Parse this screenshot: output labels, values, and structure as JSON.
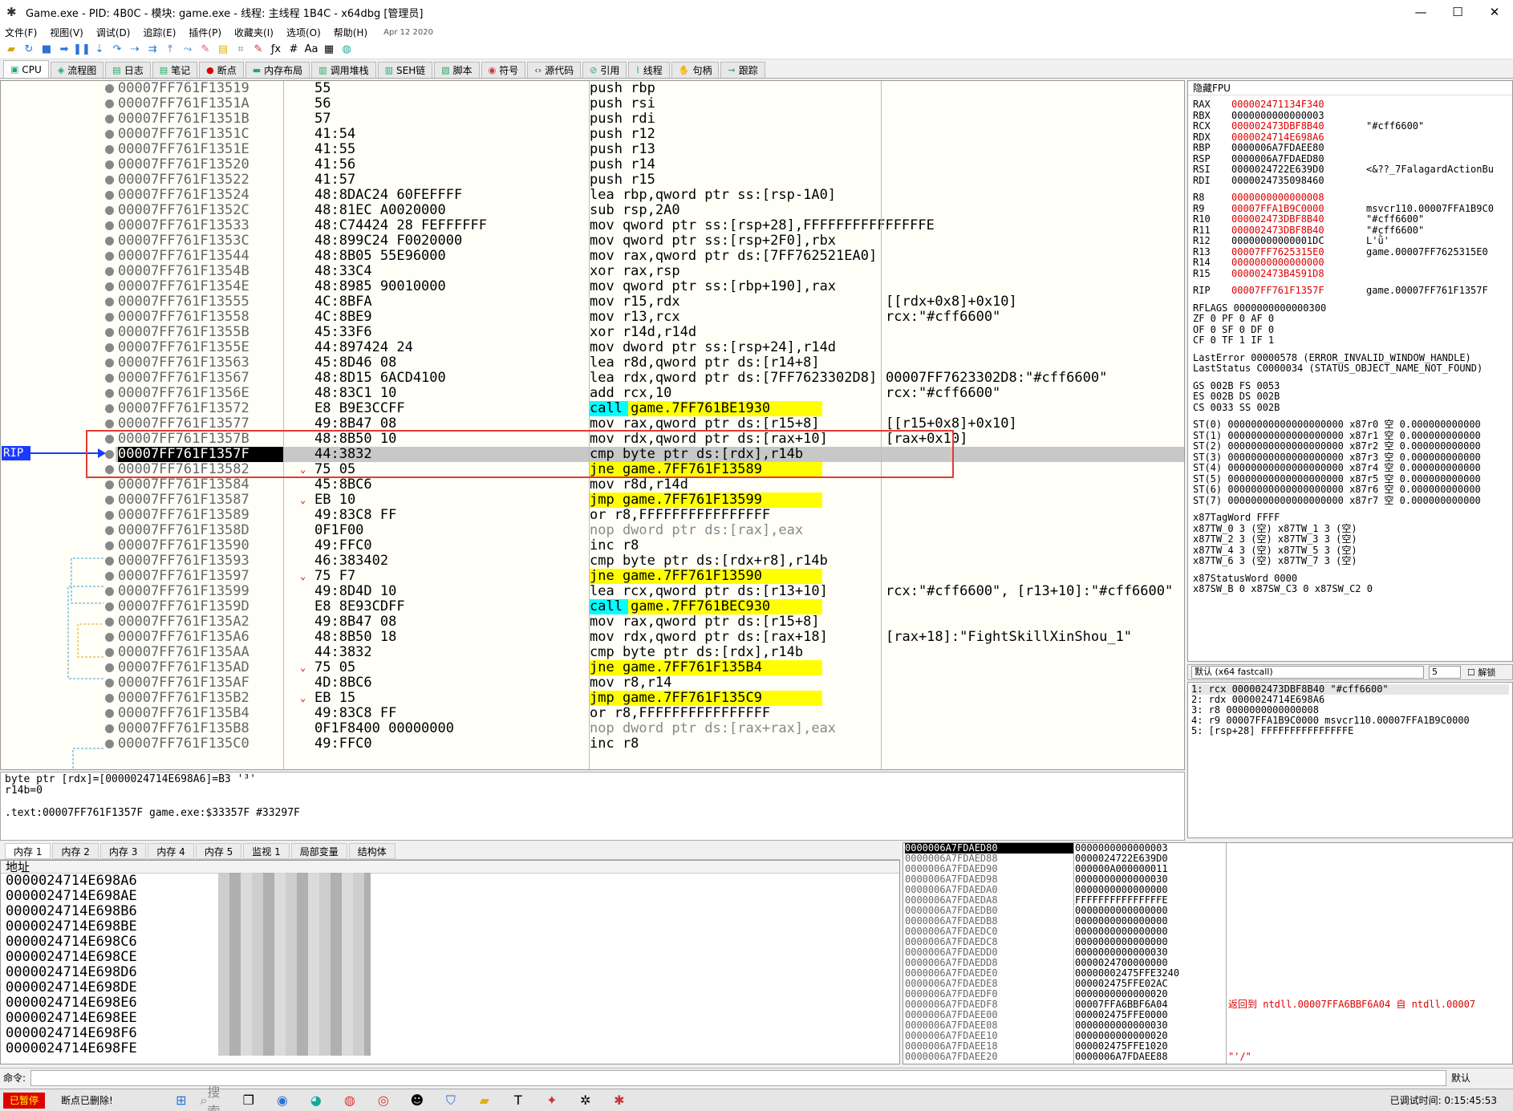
{
  "window": {
    "title": "Game.exe - PID: 4B0C - 模块: game.exe - 线程: 主线程 1B4C - x64dbg [管理员]",
    "min": "—",
    "max": "☐",
    "close": "✕"
  },
  "menu": {
    "items": [
      "文件(F)",
      "视图(V)",
      "调试(D)",
      "追踪(E)",
      "插件(P)",
      "收藏夹(I)",
      "选项(O)",
      "帮助(H)"
    ],
    "date": "Apr 12 2020"
  },
  "tabs": [
    "CPU",
    "流程图",
    "日志",
    "笔记",
    "断点",
    "内存布局",
    "调用堆栈",
    "SEH链",
    "脚本",
    "符号",
    "源代码",
    "引用",
    "线程",
    "句柄",
    "跟踪"
  ],
  "disasm": {
    "rip_label": "RIP",
    "rows": [
      {
        "addr": "00007FF761F13519",
        "bytes": "55",
        "instr": "push rbp",
        "cmt": ""
      },
      {
        "addr": "00007FF761F1351A",
        "bytes": "56",
        "instr": "push rsi",
        "cmt": ""
      },
      {
        "addr": "00007FF761F1351B",
        "bytes": "57",
        "instr": "push rdi",
        "cmt": ""
      },
      {
        "addr": "00007FF761F1351C",
        "bytes": "41:54",
        "instr": "push r12",
        "cmt": ""
      },
      {
        "addr": "00007FF761F1351E",
        "bytes": "41:55",
        "instr": "push r13",
        "cmt": ""
      },
      {
        "addr": "00007FF761F13520",
        "bytes": "41:56",
        "instr": "push r14",
        "cmt": ""
      },
      {
        "addr": "00007FF761F13522",
        "bytes": "41:57",
        "instr": "push r15",
        "cmt": ""
      },
      {
        "addr": "00007FF761F13524",
        "bytes": "48:8DAC24 60FEFFFF",
        "instr": "lea rbp,qword ptr ss:[rsp-1A0]",
        "cmt": ""
      },
      {
        "addr": "00007FF761F1352C",
        "bytes": "48:81EC A0020000",
        "instr": "sub rsp,2A0",
        "cmt": ""
      },
      {
        "addr": "00007FF761F13533",
        "bytes": "48:C74424 28 FEFFFFFF",
        "instr": "mov qword ptr ss:[rsp+28],FFFFFFFFFFFFFFFE",
        "cmt": ""
      },
      {
        "addr": "00007FF761F1353C",
        "bytes": "48:899C24 F0020000",
        "instr": "mov qword ptr ss:[rsp+2F0],rbx",
        "cmt": ""
      },
      {
        "addr": "00007FF761F13544",
        "bytes": "48:8B05 55E96000",
        "instr": "mov rax,qword ptr ds:[7FF762521EA0]",
        "cmt": ""
      },
      {
        "addr": "00007FF761F1354B",
        "bytes": "48:33C4",
        "instr": "xor rax,rsp",
        "cmt": ""
      },
      {
        "addr": "00007FF761F1354E",
        "bytes": "48:8985 90010000",
        "instr": "mov qword ptr ss:[rbp+190],rax",
        "cmt": ""
      },
      {
        "addr": "00007FF761F13555",
        "bytes": "4C:8BFA",
        "instr": "mov r15,rdx",
        "cmt": "[[rdx+0x8]+0x10]"
      },
      {
        "addr": "00007FF761F13558",
        "bytes": "4C:8BE9",
        "instr": "mov r13,rcx",
        "cmt": "rcx:\"#cff6600\""
      },
      {
        "addr": "00007FF761F1355B",
        "bytes": "45:33F6",
        "instr": "xor r14d,r14d",
        "cmt": ""
      },
      {
        "addr": "00007FF761F1355E",
        "bytes": "44:897424 24",
        "instr": "mov dword ptr ss:[rsp+24],r14d",
        "cmt": ""
      },
      {
        "addr": "00007FF761F13563",
        "bytes": "45:8D46 08",
        "instr": "lea r8d,qword ptr ds:[r14+8]",
        "cmt": ""
      },
      {
        "addr": "00007FF761F13567",
        "bytes": "48:8D15 6ACD4100",
        "instr": "lea rdx,qword ptr ds:[7FF7623302D8]",
        "cmt": "00007FF7623302D8:\"#cff6600\""
      },
      {
        "addr": "00007FF761F1356E",
        "bytes": "48:83C1 10",
        "instr": "add rcx,10",
        "cmt": "rcx:\"#cff6600\""
      },
      {
        "addr": "00007FF761F13572",
        "bytes": "E8 B9E3CCFF",
        "instr": "call game.7FF761BE1930",
        "cmt": ""
      },
      {
        "addr": "00007FF761F13577",
        "bytes": "49:8B47 08",
        "instr": "mov rax,qword ptr ds:[r15+8]",
        "cmt": "[[r15+0x8]+0x10]"
      },
      {
        "addr": "00007FF761F1357B",
        "bytes": "48:8B50 10",
        "instr": "mov rdx,qword ptr ds:[rax+10]",
        "cmt": "[rax+0x10]"
      },
      {
        "addr": "00007FF761F1357F",
        "bytes": "44:3832",
        "instr": "cmp byte ptr ds:[rdx],r14b",
        "cmt": ""
      },
      {
        "addr": "00007FF761F13582",
        "bytes": "75 05",
        "instr": "jne game.7FF761F13589",
        "cmt": ""
      },
      {
        "addr": "00007FF761F13584",
        "bytes": "45:8BC6",
        "instr": "mov r8d,r14d",
        "cmt": ""
      },
      {
        "addr": "00007FF761F13587",
        "bytes": "EB 10",
        "instr": "jmp game.7FF761F13599",
        "cmt": ""
      },
      {
        "addr": "00007FF761F13589",
        "bytes": "49:83C8 FF",
        "instr": "or r8,FFFFFFFFFFFFFFFF",
        "cmt": ""
      },
      {
        "addr": "00007FF761F1358D",
        "bytes": "0F1F00",
        "instr": "nop dword ptr ds:[rax],eax",
        "cmt": ""
      },
      {
        "addr": "00007FF761F13590",
        "bytes": "49:FFC0",
        "instr": "inc r8",
        "cmt": ""
      },
      {
        "addr": "00007FF761F13593",
        "bytes": "46:383402",
        "instr": "cmp byte ptr ds:[rdx+r8],r14b",
        "cmt": ""
      },
      {
        "addr": "00007FF761F13597",
        "bytes": "75 F7",
        "instr": "jne game.7FF761F13590",
        "cmt": ""
      },
      {
        "addr": "00007FF761F13599",
        "bytes": "49:8D4D 10",
        "instr": "lea rcx,qword ptr ds:[r13+10]",
        "cmt": "rcx:\"#cff6600\", [r13+10]:\"#cff6600\""
      },
      {
        "addr": "00007FF761F1359D",
        "bytes": "E8 8E93CDFF",
        "instr": "call game.7FF761BEC930",
        "cmt": ""
      },
      {
        "addr": "00007FF761F135A2",
        "bytes": "49:8B47 08",
        "instr": "mov rax,qword ptr ds:[r15+8]",
        "cmt": ""
      },
      {
        "addr": "00007FF761F135A6",
        "bytes": "48:8B50 18",
        "instr": "mov rdx,qword ptr ds:[rax+18]",
        "cmt": "[rax+18]:\"FightSkillXinShou_1\""
      },
      {
        "addr": "00007FF761F135AA",
        "bytes": "44:3832",
        "instr": "cmp byte ptr ds:[rdx],r14b",
        "cmt": ""
      },
      {
        "addr": "00007FF761F135AD",
        "bytes": "75 05",
        "instr": "jne game.7FF761F135B4",
        "cmt": ""
      },
      {
        "addr": "00007FF761F135AF",
        "bytes": "4D:8BC6",
        "instr": "mov r8,r14",
        "cmt": ""
      },
      {
        "addr": "00007FF761F135B2",
        "bytes": "EB 15",
        "instr": "jmp game.7FF761F135C9",
        "cmt": ""
      },
      {
        "addr": "00007FF761F135B4",
        "bytes": "49:83C8 FF",
        "instr": "or r8,FFFFFFFFFFFFFFFF",
        "cmt": ""
      },
      {
        "addr": "00007FF761F135B8",
        "bytes": "0F1F8400 00000000",
        "instr": "nop dword ptr ds:[rax+rax],eax",
        "cmt": ""
      },
      {
        "addr": "00007FF761F135C0",
        "bytes": "49:FFC0",
        "instr": "inc r8",
        "cmt": ""
      }
    ]
  },
  "info": {
    "line1": "byte ptr [rdx]=[0000024714E698A6]=B3 '³'",
    "line2": "r14b=0",
    "line3": ".text:00007FF761F1357F game.exe:$33357F #33297F"
  },
  "regs": {
    "header": "隐藏FPU",
    "gpr": [
      {
        "n": "RAX",
        "v": "000002471134F340",
        "c": "",
        "chg": true
      },
      {
        "n": "RBX",
        "v": "0000000000000003",
        "c": "",
        "chg": false
      },
      {
        "n": "RCX",
        "v": "000002473DBF8B40",
        "c": "\"#cff6600\"",
        "chg": true
      },
      {
        "n": "RDX",
        "v": "0000024714E698A6",
        "c": "",
        "chg": true
      },
      {
        "n": "RBP",
        "v": "0000006A7FDAEE80",
        "c": "",
        "chg": false
      },
      {
        "n": "RSP",
        "v": "0000006A7FDAED80",
        "c": "",
        "chg": false
      },
      {
        "n": "RSI",
        "v": "0000024722E639D0",
        "c": "<&??_7FalagardActionBu",
        "chg": false
      },
      {
        "n": "RDI",
        "v": "0000024735098460",
        "c": "",
        "chg": false
      }
    ],
    "ext": [
      {
        "n": "R8",
        "v": "0000000000000008",
        "c": "",
        "chg": true
      },
      {
        "n": "R9",
        "v": "00007FFA1B9C0000",
        "c": "msvcr110.00007FFA1B9C0",
        "chg": true
      },
      {
        "n": "R10",
        "v": "000002473DBF8B40",
        "c": "\"#cff6600\"",
        "chg": true
      },
      {
        "n": "R11",
        "v": "000002473DBF8B40",
        "c": "\"#cff6600\"",
        "chg": true
      },
      {
        "n": "R12",
        "v": "00000000000001DC",
        "c": "L'ǜ'",
        "chg": false
      },
      {
        "n": "R13",
        "v": "00007FF7625315E0",
        "c": "game.00007FF7625315E0",
        "chg": true
      },
      {
        "n": "R14",
        "v": "0000000000000000",
        "c": "",
        "chg": true
      },
      {
        "n": "R15",
        "v": "000002473B4591D8",
        "c": "",
        "chg": true
      }
    ],
    "rip": {
      "n": "RIP",
      "v": "00007FF761F1357F",
      "c": "game.00007FF761F1357F"
    },
    "rflags": "RFLAGS   0000000000000300",
    "flags1": "ZF 0  PF 0  AF 0",
    "flags2": "OF 0  SF 0  DF 0",
    "flags3": "CF 0  TF 1  IF 1",
    "lasterror": "LastError  00000578 (ERROR_INVALID_WINDOW_HANDLE)",
    "laststatus": "LastStatus C0000034 (STATUS_OBJECT_NAME_NOT_FOUND)",
    "seg1": "GS 002B  FS 0053",
    "seg2": "ES 002B  DS 002B",
    "seg3": "CS 0033  SS 002B",
    "st": [
      "ST(0) 00000000000000000000 x87r0 空 0.000000000000",
      "ST(1) 00000000000000000000 x87r1 空 0.000000000000",
      "ST(2) 00000000000000000000 x87r2 空 0.000000000000",
      "ST(3) 00000000000000000000 x87r3 空 0.000000000000",
      "ST(4) 00000000000000000000 x87r4 空 0.000000000000",
      "ST(5) 00000000000000000000 x87r5 空 0.000000000000",
      "ST(6) 00000000000000000000 x87r6 空 0.000000000000",
      "ST(7) 00000000000000000000 x87r7 空 0.000000000000"
    ],
    "tag": [
      "x87TagWord FFFF",
      "x87TW_0 3 (空)      x87TW_1 3 (空)",
      "x87TW_2 3 (空)      x87TW_3 3 (空)",
      "x87TW_4 3 (空)      x87TW_5 3 (空)",
      "x87TW_6 3 (空)      x87TW_7 3 (空)"
    ],
    "status": [
      "x87StatusWord 0000",
      "x87SW_B  0  x87SW_C3  0  x87SW_C2  0"
    ]
  },
  "callconv": {
    "select": "默认 (x64 fastcall)",
    "count": "5",
    "unlock": "解锁"
  },
  "args": [
    "1: rcx 000002473DBF8B40 \"#cff6600\"",
    "2: rdx 0000024714E698A6",
    "3: r8 0000000000000008",
    "4: r9 00007FFA1B9C0000 msvcr110.00007FFA1B9C0000",
    "5: [rsp+28] FFFFFFFFFFFFFFFE"
  ],
  "btabs": [
    "内存 1",
    "内存 2",
    "内存 3",
    "内存 4",
    "内存 5",
    "监视 1",
    "局部变量",
    "结构体"
  ],
  "dump": {
    "col_addr": "地址",
    "rows": [
      "0000024714E698A6",
      "0000024714E698AE",
      "0000024714E698B6",
      "0000024714E698BE",
      "0000024714E698C6",
      "0000024714E698CE",
      "0000024714E698D6",
      "0000024714E698DE",
      "0000024714E698E6",
      "0000024714E698EE",
      "0000024714E698F6",
      "0000024714E698FE"
    ]
  },
  "stack": [
    {
      "a": "0000006A7FDAED80",
      "v": "0000000000000003",
      "c": ""
    },
    {
      "a": "0000006A7FDAED88",
      "v": "0000024722E639D0",
      "c": ""
    },
    {
      "a": "0000006A7FDAED90",
      "v": "000000A000000011",
      "c": ""
    },
    {
      "a": "0000006A7FDAED98",
      "v": "0000000000000030",
      "c": ""
    },
    {
      "a": "0000006A7FDAEDA0",
      "v": "0000000000000000",
      "c": ""
    },
    {
      "a": "0000006A7FDAEDA8",
      "v": "FFFFFFFFFFFFFFFE",
      "c": ""
    },
    {
      "a": "0000006A7FDAEDB0",
      "v": "0000000000000000",
      "c": ""
    },
    {
      "a": "0000006A7FDAEDB8",
      "v": "0000000000000000",
      "c": ""
    },
    {
      "a": "0000006A7FDAEDC0",
      "v": "0000000000000000",
      "c": ""
    },
    {
      "a": "0000006A7FDAEDC8",
      "v": "0000000000000000",
      "c": ""
    },
    {
      "a": "0000006A7FDAEDD0",
      "v": "0000000000000030",
      "c": ""
    },
    {
      "a": "0000006A7FDAEDD8",
      "v": "0000024700000000",
      "c": ""
    },
    {
      "a": "0000006A7FDAEDE0",
      "v": "00000002475FFE3240",
      "c": ""
    },
    {
      "a": "0000006A7FDAEDE8",
      "v": "000002475FFE02AC",
      "c": ""
    },
    {
      "a": "0000006A7FDAEDF0",
      "v": "0000000000000020",
      "c": ""
    },
    {
      "a": "0000006A7FDAEDF8",
      "v": "00007FFA6BBF6A04",
      "c": "返回到 ntdll.00007FFA6BBF6A04 自 ntdll.00007"
    },
    {
      "a": "0000006A7FDAEE00",
      "v": "000002475FFE0000",
      "c": ""
    },
    {
      "a": "0000006A7FDAEE08",
      "v": "0000000000000030",
      "c": ""
    },
    {
      "a": "0000006A7FDAEE10",
      "v": "0000000000000020",
      "c": ""
    },
    {
      "a": "0000006A7FDAEE18",
      "v": "000002475FFE1020",
      "c": ""
    },
    {
      "a": "0000006A7FDAEE20",
      "v": "0000006A7FDAEE88",
      "c": "\"'/\""
    }
  ],
  "cmd": {
    "label": "命令:",
    "default": "默认"
  },
  "status": {
    "paused": "已暂停",
    "msg": "断点已删除!",
    "search": "搜索",
    "time": "已调试时间:   0:15:45:53"
  }
}
